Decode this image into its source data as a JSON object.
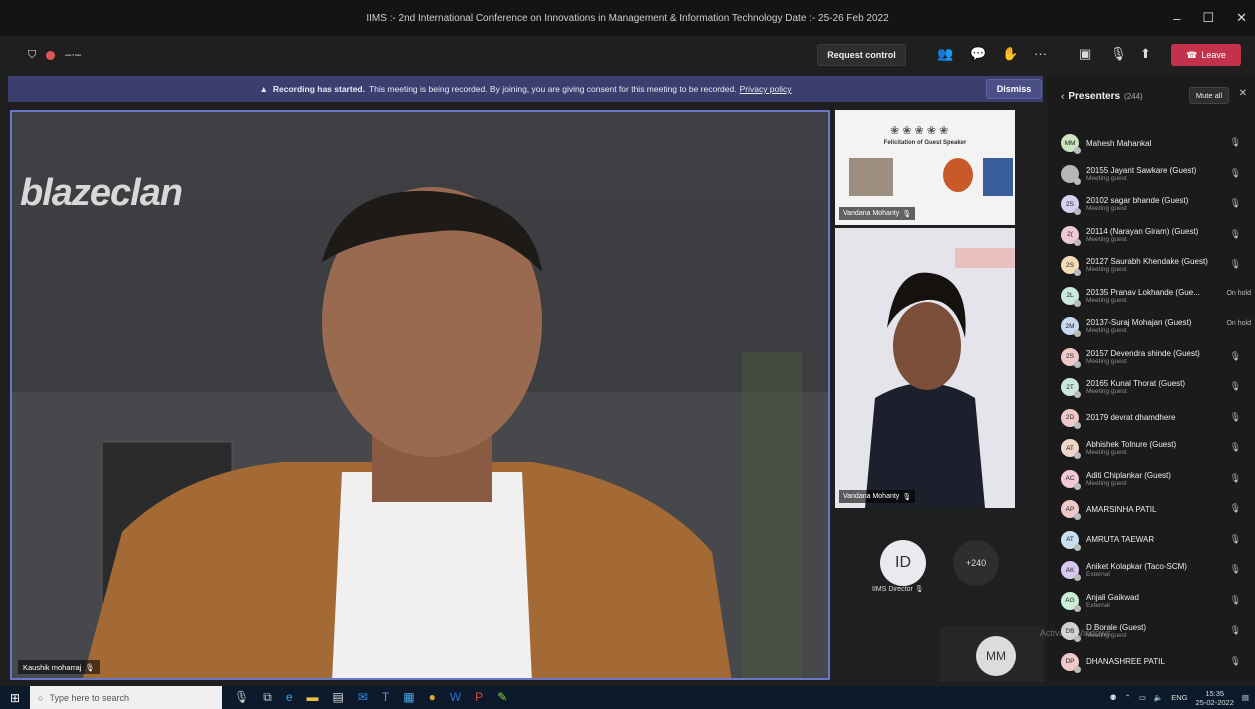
{
  "window": {
    "title": "IIMS :- 2nd International Conference on Innovations in Management & Information Technology Date :- 25-26 Feb 2022",
    "ctrl_min": "–",
    "ctrl_max": "☐",
    "ctrl_close": "✕"
  },
  "toolbar": {
    "request_control_label": "Request control",
    "leave_label": "Leave"
  },
  "banner": {
    "bold": "Recording has started.",
    "text": "This meeting is being recorded. By joining, you are giving consent for this meeting to be recorded.",
    "link": "Privacy policy",
    "dismiss_label": "Dismiss"
  },
  "main_video": {
    "logo": "blazeclan",
    "speaker_name": "Kaushik moharraj"
  },
  "tiles": {
    "tile1_label": "Vandana Mohanty",
    "tile1_heading": "Felicitation of Guest Speaker",
    "tile2_label": "Vandana Mohanty",
    "id_initials": "ID",
    "id_label": "IIMS Director",
    "more_count": "+240",
    "mm_initials": "MM"
  },
  "panel": {
    "title": "Presenters",
    "count": "(244)",
    "mute_all_label": "Mute all",
    "participants": [
      {
        "initials": "MM",
        "name": "Mahesh Mahankal",
        "sub": "",
        "status": "mic",
        "color": "#c9e6c0"
      },
      {
        "initials": "",
        "name": "20155 Jayant Sawkare (Guest)",
        "sub": "Meeting guest",
        "status": "mic",
        "color": "#b7b7b7"
      },
      {
        "initials": "2S",
        "name": "20102 sagar bhande (Guest)",
        "sub": "Meeting guest",
        "status": "mic",
        "color": "#d8d0f0"
      },
      {
        "initials": "2(",
        "name": "20114 (Narayan Giram) (Guest)",
        "sub": "Meeting guest",
        "status": "mic",
        "color": "#f0c9d6"
      },
      {
        "initials": "2S",
        "name": "20127 Saurabh Khendake (Guest)",
        "sub": "Meeting guest",
        "status": "mic",
        "color": "#f4dcb4"
      },
      {
        "initials": "2L",
        "name": "20135 Pranav Lokhande (Gue...",
        "sub": "Meeting guest",
        "status": "On hold",
        "color": "#c8e8e0"
      },
      {
        "initials": "2M",
        "name": "20137-Suraj Mohajan (Guest)",
        "sub": "Meeting guest",
        "status": "On hold",
        "color": "#c8d8f0"
      },
      {
        "initials": "2S",
        "name": "20157 Devendra shinde (Guest)",
        "sub": "Meeting guest",
        "status": "mic",
        "color": "#f0c8c8"
      },
      {
        "initials": "2T",
        "name": "20165 Kunal Thorat (Guest)",
        "sub": "Meeting guest",
        "status": "mic",
        "color": "#c8e8e0"
      },
      {
        "initials": "2D",
        "name": "20179 devrat dhamdhere",
        "sub": "",
        "status": "mic",
        "color": "#f0c8c8"
      },
      {
        "initials": "AT",
        "name": "Abhishek Tolnure (Guest)",
        "sub": "Meeting guest",
        "status": "mic",
        "color": "#f0d6c8"
      },
      {
        "initials": "AC",
        "name": "Aditi Chiplankar (Guest)",
        "sub": "Meeting guest",
        "status": "mic",
        "color": "#f0c8d8"
      },
      {
        "initials": "AP",
        "name": "AMARSINHA PATIL",
        "sub": "",
        "status": "mic",
        "color": "#f0c8c8"
      },
      {
        "initials": "AT",
        "name": "AMRUTA TAEWAR",
        "sub": "",
        "status": "mic",
        "color": "#c8e0f0"
      },
      {
        "initials": "AK",
        "name": "Aniket Kolapkar (Taco-SCM)",
        "sub": "External",
        "status": "mic",
        "color": "#d6c8f0"
      },
      {
        "initials": "AG",
        "name": "Anjali Gaikwad",
        "sub": "External",
        "status": "mic",
        "color": "#c8f0d8"
      },
      {
        "initials": "DB",
        "name": "D Borale (Guest)",
        "sub": "Meeting guest",
        "status": "mic",
        "color": "#d0d0d0"
      },
      {
        "initials": "DP",
        "name": "DHANASHREE PATIL",
        "sub": "",
        "status": "mic",
        "color": "#f0c8c8"
      }
    ]
  },
  "taskbar": {
    "search_placeholder": "Type here to search",
    "lang": "ENG",
    "time": "15:35",
    "date": "25-02-2022"
  },
  "watermark": "Activate Windows"
}
